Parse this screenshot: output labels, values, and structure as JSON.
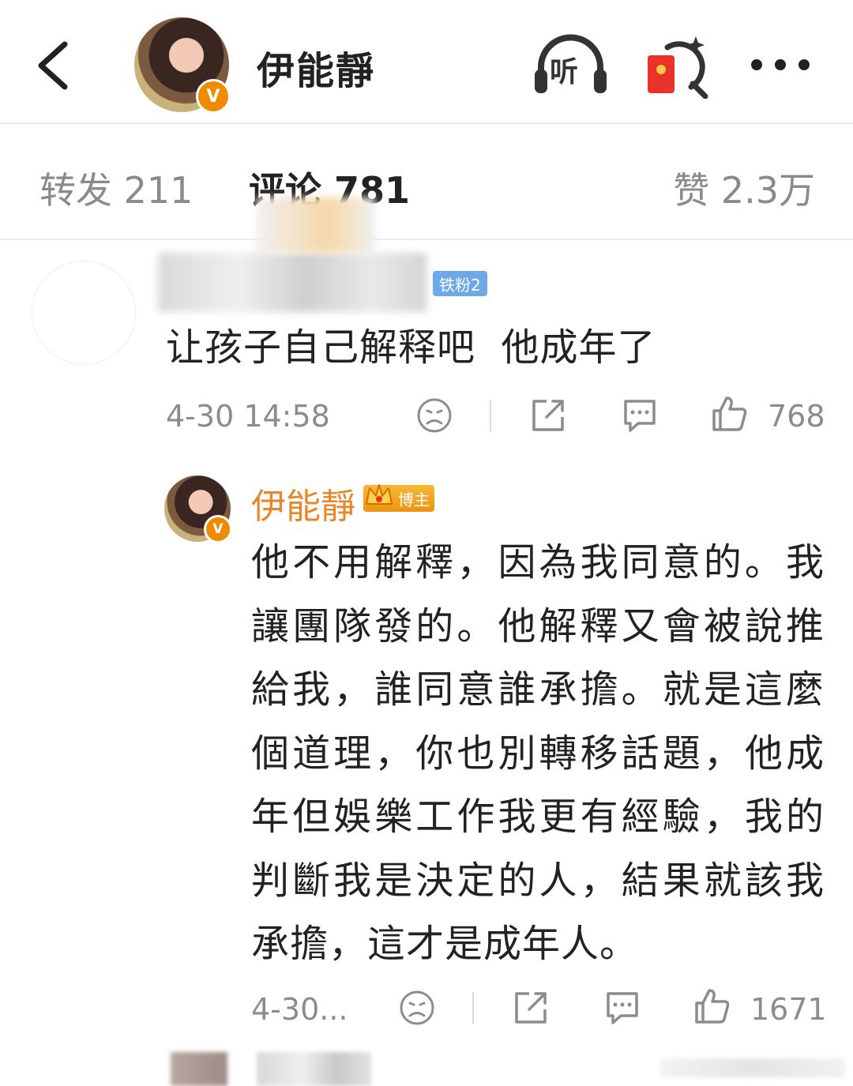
{
  "header": {
    "title": "伊能靜",
    "listen_label": "听"
  },
  "tabs": {
    "repost": "转发 211",
    "comments": "评论 781",
    "likes": "赞 2.3万"
  },
  "comment1": {
    "badge": "铁粉2",
    "text": "让孩子自己解释吧  他成年了",
    "time": "4-30 14:58",
    "likes": "768"
  },
  "reply": {
    "name": "伊能靜",
    "badge": "博主",
    "text": "他不用解釋，因為我同意的。我讓團隊發的。他解釋又會被說推給我，誰同意誰承擔。就是這麼個道理，你也別轉移話題，他成年但娛樂工作我更有經驗，我的判斷我是決定的人，結果就該我承擔，這才是成年人。",
    "time": "4-30...",
    "likes": "1671"
  },
  "colors": {
    "accent_name": "#e8862a",
    "verified_badge": "#f08a00",
    "fan_badge": "#6fa8e8",
    "muted_text": "#8c8c8c"
  }
}
